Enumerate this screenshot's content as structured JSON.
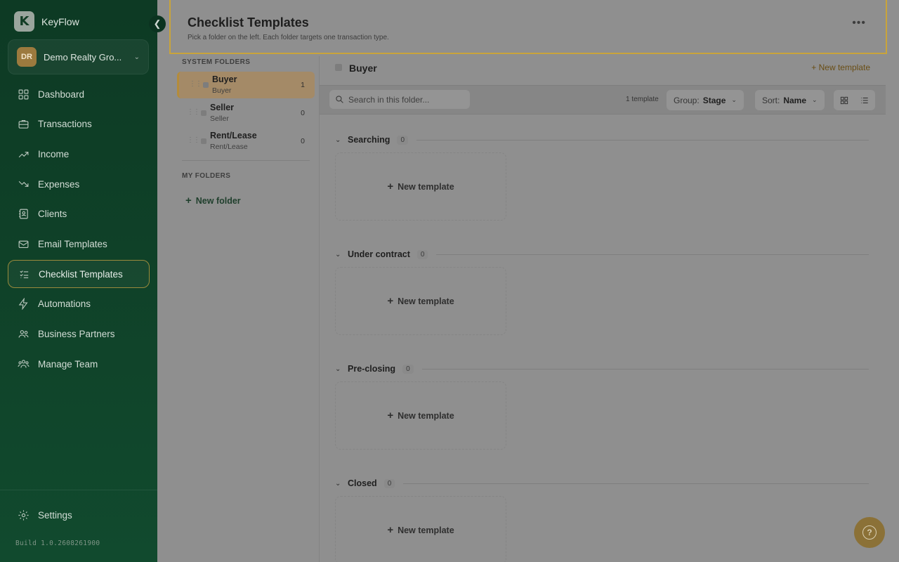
{
  "app": {
    "name": "KeyFlow",
    "logo_letter": "K"
  },
  "org": {
    "initials": "DR",
    "name": "Demo Realty Gro..."
  },
  "nav": [
    {
      "label": "Dashboard",
      "icon": "grid-icon"
    },
    {
      "label": "Transactions",
      "icon": "briefcase-icon"
    },
    {
      "label": "Income",
      "icon": "trending-up-icon"
    },
    {
      "label": "Expenses",
      "icon": "trending-down-icon"
    },
    {
      "label": "Clients",
      "icon": "contacts-book-icon"
    },
    {
      "label": "Email Templates",
      "icon": "mail-icon"
    },
    {
      "label": "Checklist Templates",
      "icon": "checklist-icon",
      "active": true
    },
    {
      "label": "Automations",
      "icon": "lightning-icon"
    },
    {
      "label": "Business Partners",
      "icon": "users-icon"
    },
    {
      "label": "Manage Team",
      "icon": "team-icon"
    }
  ],
  "settings_label": "Settings",
  "build": "Build 1.0.2608261900",
  "header": {
    "title": "Checklist Templates",
    "subtitle": "Pick a folder on the left. Each folder targets one transaction type."
  },
  "folders": {
    "system_label": "SYSTEM FOLDERS",
    "system": [
      {
        "name": "Buyer",
        "sub": "Buyer",
        "count": "1"
      },
      {
        "name": "Seller",
        "sub": "Seller",
        "count": "0"
      },
      {
        "name": "Rent/Lease",
        "sub": "Rent/Lease",
        "count": "0"
      }
    ],
    "my_label": "MY FOLDERS",
    "new_folder": "New folder"
  },
  "content": {
    "folder_title": "Buyer",
    "new_template_link": "+ New template",
    "search_placeholder": "Search in this folder...",
    "template_count": "1 template",
    "group_label": "Group:",
    "group_value": "Stage",
    "sort_label": "Sort:",
    "sort_value": "Name",
    "groups": [
      {
        "name": "Searching",
        "count": "0",
        "card": "New template"
      },
      {
        "name": "Under contract",
        "count": "0",
        "card": "New template"
      },
      {
        "name": "Pre-closing",
        "count": "0",
        "card": "New template"
      },
      {
        "name": "Closed",
        "count": "0",
        "card": "New template"
      }
    ]
  },
  "colors": {
    "accent": "#c9a43a",
    "sidebar": "#0f4128",
    "overlay": "#8f8f8f"
  }
}
